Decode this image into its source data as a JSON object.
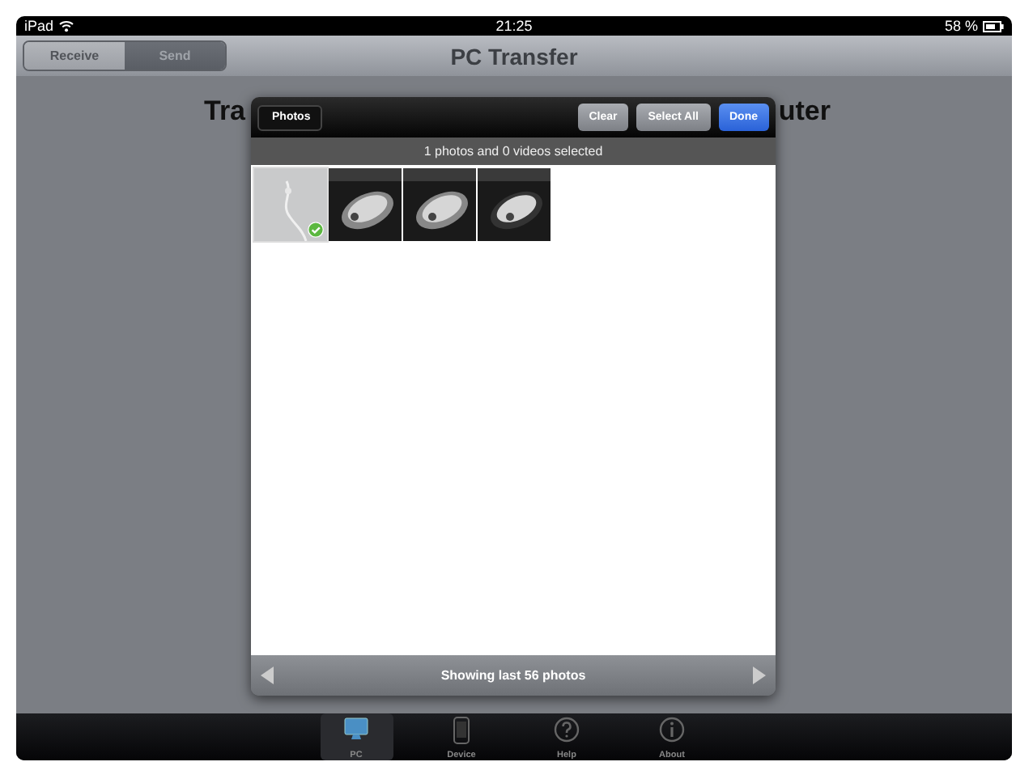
{
  "status_bar": {
    "device": "iPad",
    "time": "21:25",
    "battery": "58 %"
  },
  "nav_bar": {
    "title": "PC Transfer",
    "segments": [
      {
        "label": "Receive",
        "selected": false
      },
      {
        "label": "Send",
        "selected": true
      }
    ]
  },
  "heading_parts": [
    "Tra",
    "uter"
  ],
  "picker": {
    "back": "Photos",
    "buttons": [
      {
        "label": "Clear",
        "kind": "plain"
      },
      {
        "label": "Select All",
        "kind": "plain"
      },
      {
        "label": "Done",
        "kind": "primary"
      }
    ],
    "summary": "1 photos and 0 videos selected",
    "photos": [
      {
        "kind": "picture",
        "selected": true
      },
      {
        "kind": "picture",
        "selected": false
      },
      {
        "kind": "picture",
        "selected": false
      },
      {
        "kind": "picture",
        "selected": false
      }
    ],
    "footer": "Showing last 56 photos"
  },
  "tab_bar": [
    {
      "label": "PC",
      "selected": true
    },
    {
      "label": "Device",
      "selected": false
    },
    {
      "label": "Help",
      "selected": false
    },
    {
      "label": "About",
      "selected": false
    }
  ]
}
